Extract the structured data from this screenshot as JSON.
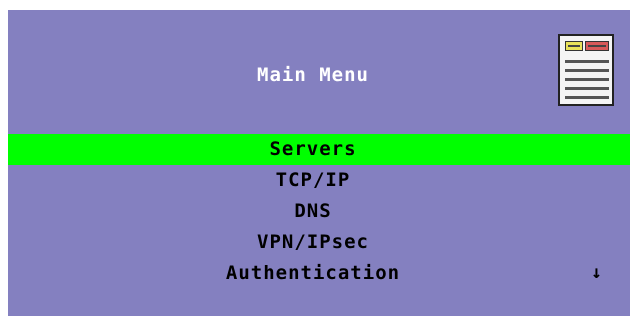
{
  "header": {
    "title": "Main Menu",
    "icon": "server-icon"
  },
  "menu": {
    "items": [
      {
        "label": "Servers",
        "selected": true
      },
      {
        "label": "TCP/IP",
        "selected": false
      },
      {
        "label": "DNS",
        "selected": false
      },
      {
        "label": "VPN/IPsec",
        "selected": false
      },
      {
        "label": "Authentication",
        "selected": false
      }
    ],
    "scroll_indicator": "↓"
  },
  "colors": {
    "background": "#8480c0",
    "selection": "#00ff00",
    "title_text": "#ffffff",
    "item_text": "#000000"
  }
}
